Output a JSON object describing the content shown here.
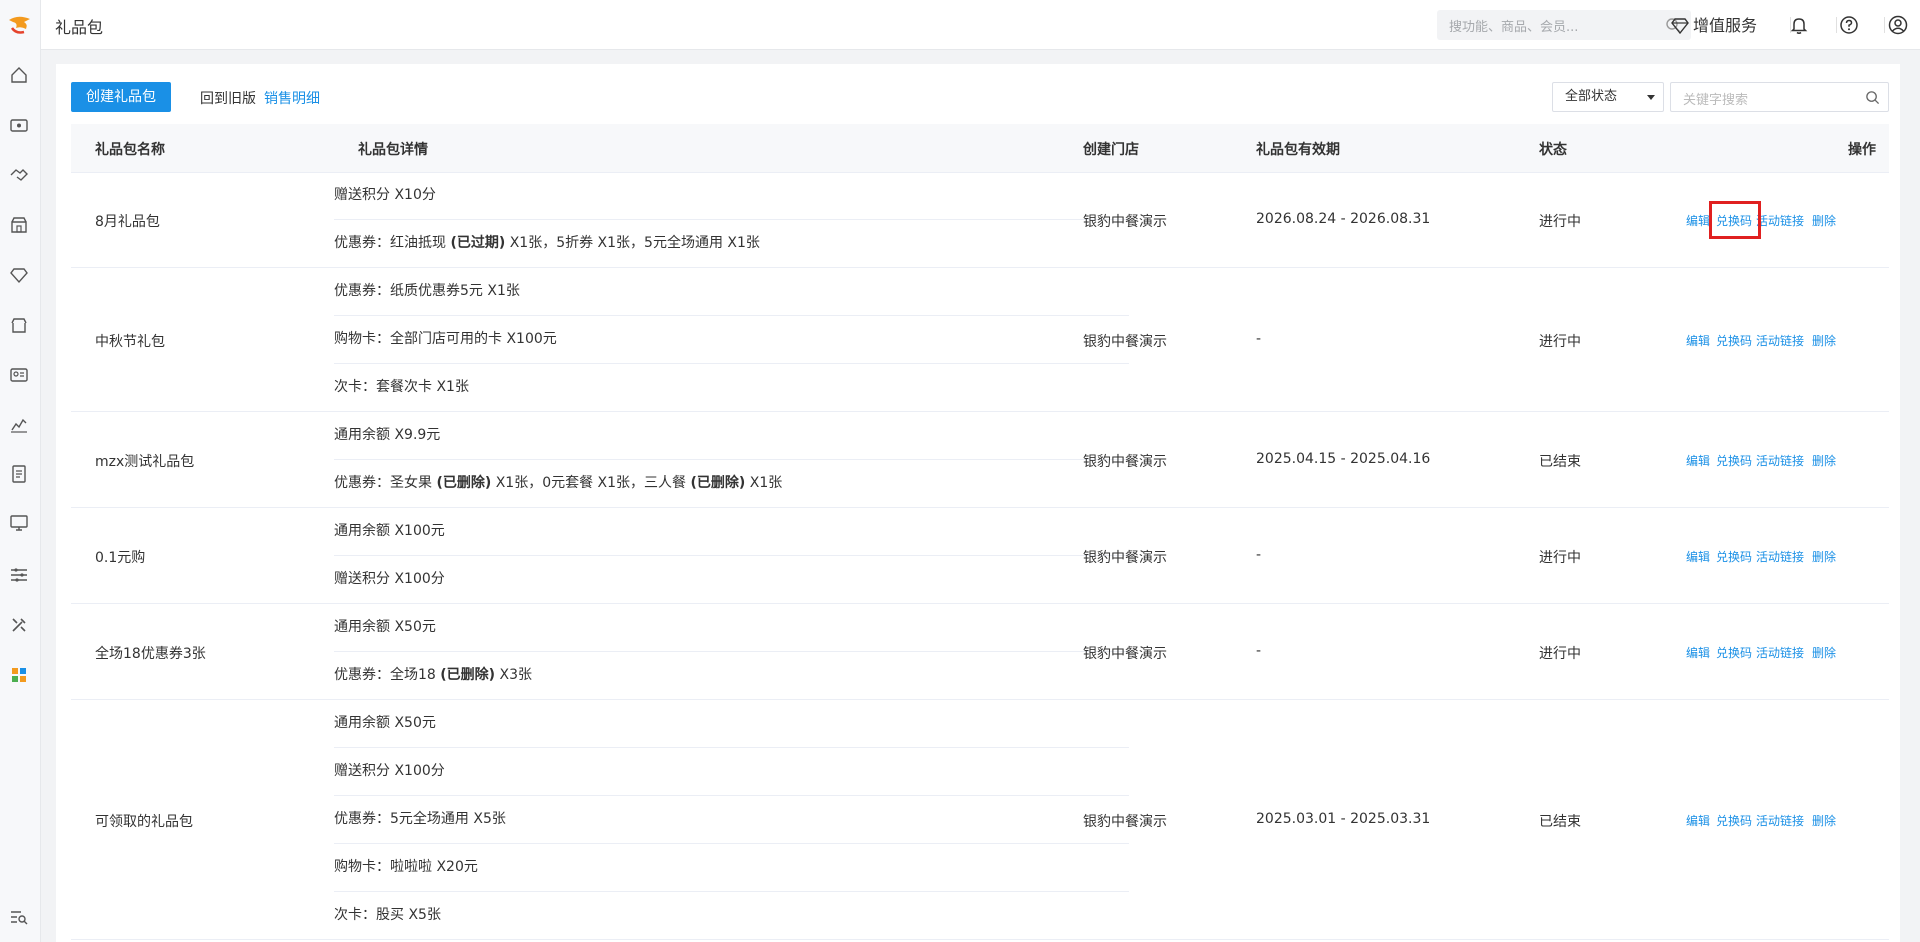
{
  "header": {
    "title": "礼品包",
    "search_placeholder": "搜功能、商品、会员...",
    "value_added_label": "增值服务"
  },
  "sidebar": {
    "icons": [
      "home-icon",
      "wallet-icon",
      "handshake-icon",
      "store-icon",
      "diamond-icon",
      "shop-icon",
      "member-card-icon",
      "chart-icon",
      "report-icon",
      "monitor-icon",
      "settings-sliders-icon",
      "tools-icon",
      "apps-icon",
      "search-list-icon"
    ]
  },
  "toolbar": {
    "create_label": "创建礼品包",
    "old_version_label": "回到旧版",
    "sales_detail_label": "销售明细",
    "status_filter": "全部状态",
    "keyword_placeholder": "关键字搜索"
  },
  "table": {
    "columns": [
      "礼品包名称",
      "礼品包详情",
      "创建门店",
      "礼品包有效期",
      "状态",
      "操作"
    ],
    "actions": [
      "编辑",
      "兑换码",
      "活动链接",
      "删除"
    ],
    "rows": [
      {
        "name": "8月礼品包",
        "details": [
          [
            {
              "t": "赠送积分 X10分"
            }
          ],
          [
            {
              "t": "优惠券：红油抵现 "
            },
            {
              "t": "(已过期)",
              "b": true
            },
            {
              "t": " X1张，5折券 X1张，5元全场通用 X1张"
            }
          ]
        ],
        "store": "银豹中餐演示",
        "validity": "2026.08.24 - 2026.08.31",
        "status": "进行中"
      },
      {
        "name": "中秋节礼包",
        "details": [
          [
            {
              "t": "优惠券：纸质优惠券5元 X1张"
            }
          ],
          [
            {
              "t": "购物卡：全部门店可用的卡 X100元"
            }
          ],
          [
            {
              "t": "次卡：套餐次卡 X1张"
            }
          ]
        ],
        "store": "银豹中餐演示",
        "validity": "-",
        "status": "进行中"
      },
      {
        "name": "mzx测试礼品包",
        "details": [
          [
            {
              "t": "通用余额 X9.9元"
            }
          ],
          [
            {
              "t": "优惠券：圣女果 "
            },
            {
              "t": "(已删除)",
              "b": true
            },
            {
              "t": " X1张，0元套餐 X1张，三人餐 "
            },
            {
              "t": "(已删除)",
              "b": true
            },
            {
              "t": " X1张"
            }
          ]
        ],
        "store": "银豹中餐演示",
        "validity": "2025.04.15 - 2025.04.16",
        "status": "已结束"
      },
      {
        "name": "0.1元购",
        "details": [
          [
            {
              "t": "通用余额 X100元"
            }
          ],
          [
            {
              "t": "赠送积分 X100分"
            }
          ]
        ],
        "store": "银豹中餐演示",
        "validity": "-",
        "status": "进行中"
      },
      {
        "name": "全场18优惠券3张",
        "details": [
          [
            {
              "t": "通用余额 X50元"
            }
          ],
          [
            {
              "t": "优惠券：全场18 "
            },
            {
              "t": "(已删除)",
              "b": true
            },
            {
              "t": " X3张"
            }
          ]
        ],
        "store": "银豹中餐演示",
        "validity": "-",
        "status": "进行中"
      },
      {
        "name": "可领取的礼品包",
        "details": [
          [
            {
              "t": "通用余额 X50元"
            }
          ],
          [
            {
              "t": "赠送积分 X100分"
            }
          ],
          [
            {
              "t": "优惠券：5元全场通用 X5张"
            }
          ],
          [
            {
              "t": "购物卡：啦啦啦 X20元"
            }
          ],
          [
            {
              "t": "次卡：股买 X5张"
            }
          ]
        ],
        "store": "银豹中餐演示",
        "validity": "2025.03.01 - 2025.03.31",
        "status": "已结束"
      }
    ]
  },
  "colors": {
    "accent": "#1a90e6",
    "highlight_box": "#e02020"
  }
}
